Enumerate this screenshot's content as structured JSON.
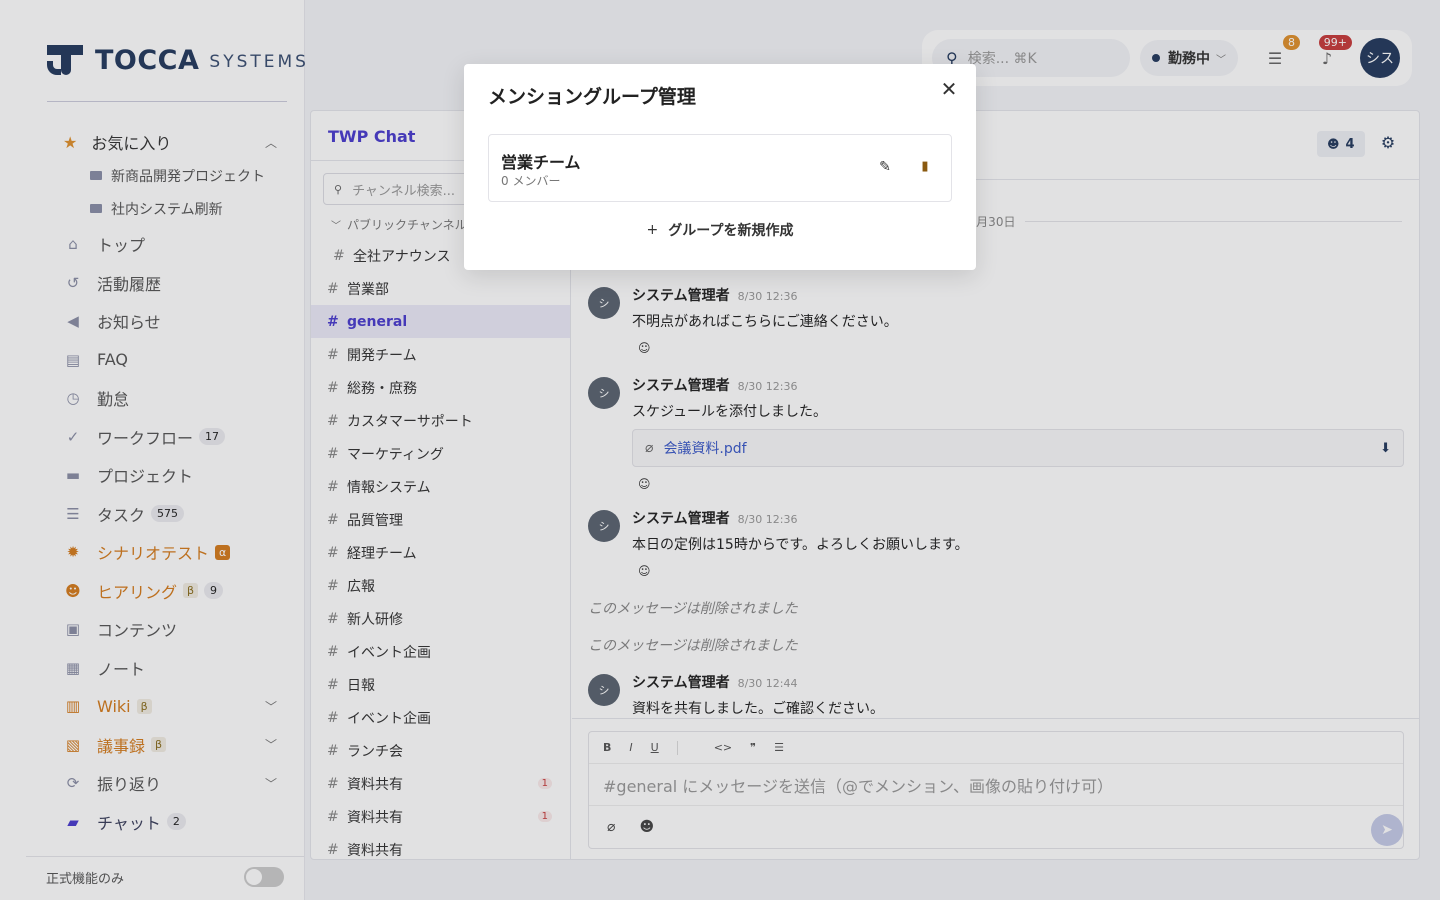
{
  "logo": {
    "name": "TOCCA",
    "sub": "SYSTEMS"
  },
  "sidebar": {
    "favorites_label": "お気に入り",
    "favorites_items": [
      "新商品開発プロジェクト",
      "社内システム刷新"
    ],
    "items": [
      {
        "label": "トップ",
        "icon": "home-icon"
      },
      {
        "label": "活動履歴",
        "icon": "history-icon"
      },
      {
        "label": "お知らせ",
        "icon": "megaphone-icon"
      },
      {
        "label": "FAQ",
        "icon": "faq-icon"
      },
      {
        "label": "勤怠",
        "icon": "clock-icon"
      },
      {
        "label": "ワークフロー",
        "icon": "check-circle-icon",
        "badge": "17"
      },
      {
        "label": "プロジェクト",
        "icon": "folder-icon"
      },
      {
        "label": "タスク",
        "icon": "tasks-icon",
        "badge": "575"
      },
      {
        "label": "シナリオテスト",
        "icon": "bug-icon",
        "tag": "α"
      },
      {
        "label": "ヒアリング",
        "icon": "people-icon",
        "tag": "β",
        "badge": "9"
      },
      {
        "label": "コンテンツ",
        "icon": "content-icon"
      },
      {
        "label": "ノート",
        "icon": "note-icon"
      },
      {
        "label": "Wiki",
        "icon": "book-icon",
        "tag": "β"
      },
      {
        "label": "議事録",
        "icon": "calendar-icon",
        "tag": "β"
      },
      {
        "label": "振り返り",
        "icon": "refresh-icon"
      },
      {
        "label": "チャット",
        "icon": "chat-icon",
        "badge": "2"
      }
    ],
    "footer_label": "正式機能のみ"
  },
  "topbar": {
    "search_placeholder": "検索... ⌘K",
    "status": "勤務中",
    "tasks_badge": "8",
    "notifications_badge": "99+",
    "avatar": "シス"
  },
  "chat": {
    "title": "TWP Chat",
    "channel_search_placeholder": "チャンネル検索...",
    "group_label": "パブリックチャンネル",
    "channels": [
      {
        "name": "全社アナウンス"
      },
      {
        "name": "営業部"
      },
      {
        "name": "general",
        "active": true
      },
      {
        "name": "開発チーム"
      },
      {
        "name": "総務・庶務"
      },
      {
        "name": "カスタマーサポート"
      },
      {
        "name": "マーケティング"
      },
      {
        "name": "情報システム"
      },
      {
        "name": "品質管理"
      },
      {
        "name": "経理チーム"
      },
      {
        "name": "広報"
      },
      {
        "name": "新人研修"
      },
      {
        "name": "イベント企画"
      },
      {
        "name": "日報"
      },
      {
        "name": "イベント企画"
      },
      {
        "name": "ランチ会"
      },
      {
        "name": "資料共有",
        "unread": "1"
      },
      {
        "name": "資料共有",
        "unread": "1"
      },
      {
        "name": "資料共有"
      }
    ],
    "members_count": "4",
    "date_separator": "8月30日",
    "messages": [
      {
        "avatar": "シ",
        "name": "システム管理者",
        "time": "8/30 12:36",
        "text": "不明点があればこちらにご連絡ください。"
      },
      {
        "avatar": "シ",
        "name": "システム管理者",
        "time": "8/30 12:36",
        "text": "スケジュールを添付しました。",
        "attachment": "会議資料.pdf"
      },
      {
        "avatar": "シ",
        "name": "システム管理者",
        "time": "8/30 12:36",
        "text": "本日の定例は15時からです。よろしくお願いします。"
      },
      {
        "avatar": "シ",
        "name": "システム管理者",
        "time": "8/30 12:44",
        "text": "資料を共有しました。ご確認ください。"
      }
    ],
    "deleted_text": "このメッセージは削除されました",
    "composer_placeholder": "#general にメッセージを送信（@でメンション、画像の貼り付け可）"
  },
  "modal": {
    "title": "メンショングループ管理",
    "group": {
      "name": "営業チーム",
      "members": "0 メンバー"
    },
    "new_group_label": "グループを新規作成"
  }
}
